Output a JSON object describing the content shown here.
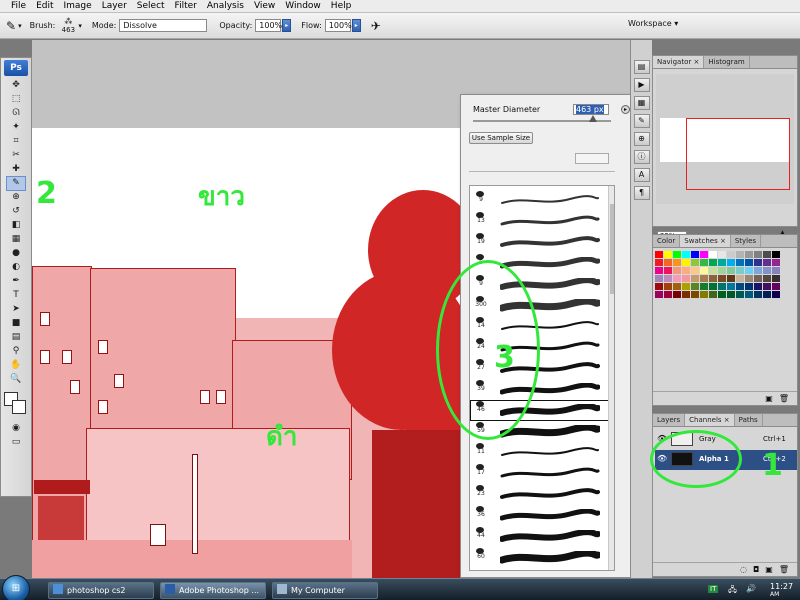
{
  "menu": [
    "File",
    "Edit",
    "Image",
    "Layer",
    "Select",
    "Filter",
    "Analysis",
    "View",
    "Window",
    "Help"
  ],
  "options": {
    "brush_label": "Brush:",
    "brush_size": "463",
    "mode_label": "Mode:",
    "mode_value": "Dissolve",
    "opacity_label": "Opacity:",
    "opacity_value": "100%",
    "flow_label": "Flow:",
    "flow_value": "100%",
    "workspace_label": "Workspace ▾"
  },
  "toolbox": {
    "logo": "Ps",
    "tools": [
      "move-icon",
      "marquee-icon",
      "lasso-icon",
      "magic-wand-icon",
      "crop-icon",
      "slice-icon",
      "healing-icon",
      "brush-icon",
      "stamp-icon",
      "history-brush-icon",
      "eraser-icon",
      "gradient-icon",
      "blur-icon",
      "dodge-icon",
      "pen-icon",
      "type-icon",
      "path-select-icon",
      "shape-icon",
      "notes-icon",
      "eyedropper-icon",
      "hand-icon",
      "zoom-icon"
    ],
    "tool_glyphs": [
      "✥",
      "⬚",
      "ᘏ",
      "✦",
      "⌗",
      "✂",
      "✚",
      "✎",
      "⊕",
      "↺",
      "◧",
      "▦",
      "●",
      "◐",
      "✒",
      "T",
      "➤",
      "■",
      "▤",
      "⚲",
      "✋",
      "🔍"
    ]
  },
  "document": {
    "annotations": {
      "two": "2",
      "white": "ขาว",
      "black": "ดำ",
      "one": "1",
      "three": "3"
    }
  },
  "brush_picker": {
    "master_diameter_label": "Master Diameter",
    "master_diameter_value": "463 px",
    "sample_button": "Use Sample Size",
    "sizes": [
      "9",
      "13",
      "19",
      "5",
      "9",
      "300",
      "14",
      "24",
      "27",
      "39",
      "46",
      "59",
      "11",
      "17",
      "23",
      "36",
      "44",
      "60"
    ]
  },
  "navigator_panel": {
    "tabs": [
      "Navigator",
      "Histogram"
    ],
    "zoom": "25%"
  },
  "swatches_panel": {
    "tabs": [
      "Color",
      "Swatches",
      "Styles"
    ],
    "colors": [
      "#ff0000",
      "#ffff00",
      "#00ff00",
      "#00ffff",
      "#0000ff",
      "#ff00ff",
      "#ffffff",
      "#e6e6e6",
      "#cccccc",
      "#b3b3b3",
      "#999999",
      "#808080",
      "#4d4d4d",
      "#000000",
      "#ee1c24",
      "#f26522",
      "#f7941d",
      "#fff200",
      "#8dc63f",
      "#39b54a",
      "#00a651",
      "#00a99d",
      "#00aeef",
      "#0072bc",
      "#0054a6",
      "#2e3192",
      "#662d91",
      "#92278f",
      "#ec008c",
      "#ed145b",
      "#f7977a",
      "#f9ad81",
      "#fdc68a",
      "#fff79a",
      "#c4df9b",
      "#a3d39c",
      "#82ca9d",
      "#7accc8",
      "#6dcff6",
      "#7da7d9",
      "#8393ca",
      "#8781bd",
      "#a186be",
      "#bd8cbf",
      "#f49ac1",
      "#f5989d",
      "#c69c6d",
      "#a67c52",
      "#8c6239",
      "#754c24",
      "#603913",
      "#c7b299",
      "#998675",
      "#736357",
      "#534741",
      "#362f2d",
      "#9e0b0f",
      "#a0410d",
      "#a36209",
      "#aba000",
      "#598527",
      "#197b30",
      "#007236",
      "#00746b",
      "#0076a3",
      "#004a80",
      "#003471",
      "#1b1464",
      "#440e62",
      "#630460",
      "#9e005d",
      "#9e0039",
      "#790000",
      "#7b2e00",
      "#7d4900",
      "#827b00",
      "#406618",
      "#005e20",
      "#005826",
      "#005952",
      "#005b7f",
      "#003663",
      "#002157",
      "#0d004c"
    ]
  },
  "layers_panel": {
    "tabs": [
      "Layers",
      "Channels",
      "Paths"
    ],
    "rows": [
      {
        "name": "Gray",
        "shortcut": "Ctrl+1"
      },
      {
        "name": "Alpha 1",
        "shortcut": "Ctrl+2"
      }
    ]
  },
  "taskbar": {
    "items": [
      "photoshop cs2",
      "Adobe Photoshop ...",
      "My Computer"
    ],
    "clock_time": "11:27",
    "clock_ampm": "AM"
  },
  "colors": {
    "accent": "#2f62b3",
    "annotation": "#33e83a",
    "mask_red": "#d12626"
  }
}
